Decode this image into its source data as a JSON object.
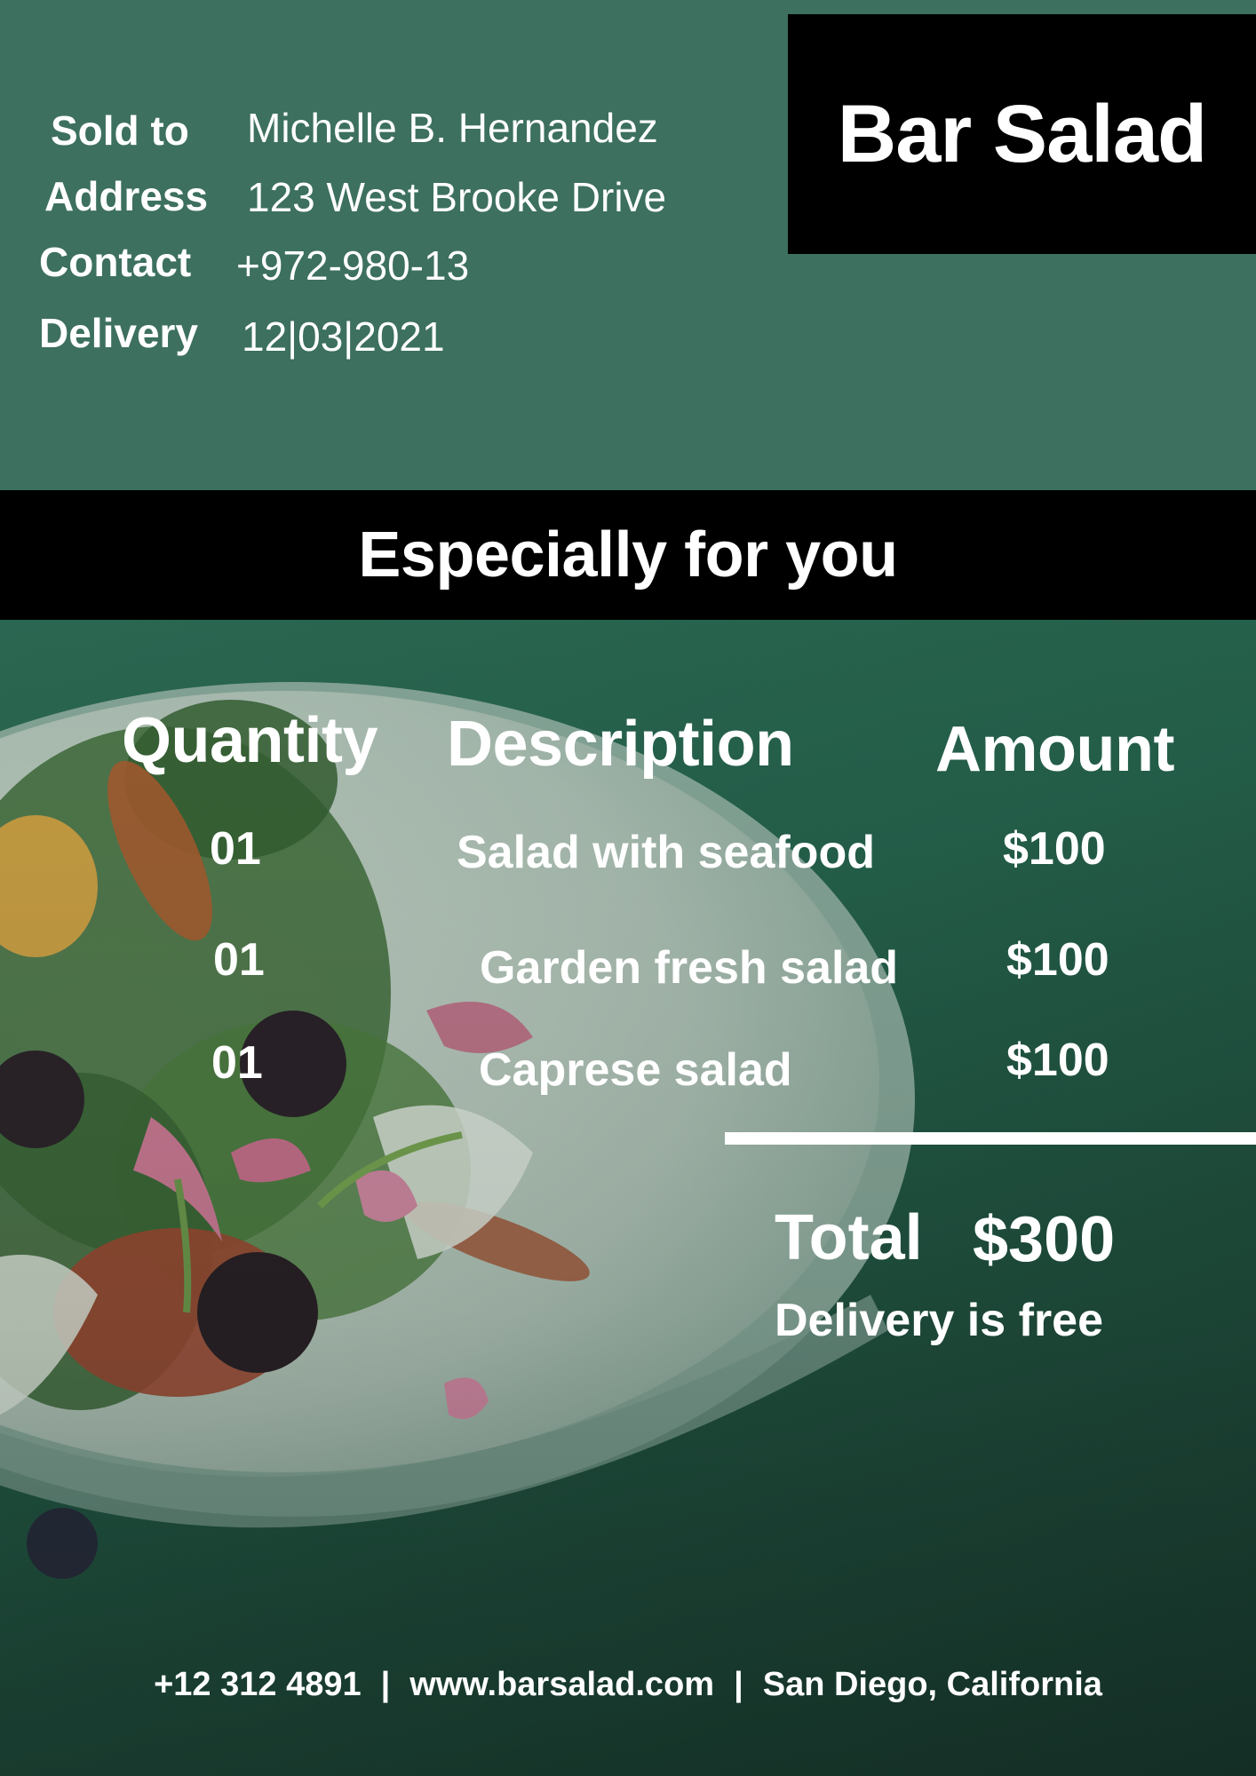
{
  "brand": {
    "name": "Bar Salad"
  },
  "customer": {
    "sold_to_label": "Sold to",
    "sold_to_value": "Michelle B. Hernandez",
    "address_label": "Address",
    "address_value": "123 West Brooke Drive",
    "contact_label": "Contact",
    "contact_value": "+972-980-13",
    "delivery_label": "Delivery",
    "delivery_value": "12|03|2021"
  },
  "banner": {
    "text": "Especially for you"
  },
  "table": {
    "headers": {
      "quantity": "Quantity",
      "description": "Description",
      "amount": "Amount"
    },
    "rows": [
      {
        "quantity": "01",
        "description": "Salad with seafood",
        "amount": "$100"
      },
      {
        "quantity": "01",
        "description": "Garden fresh salad",
        "amount": "$100"
      },
      {
        "quantity": "01",
        "description": "Caprese salad",
        "amount": "$100"
      }
    ]
  },
  "summary": {
    "total_label": "Total",
    "total_value": "$300",
    "delivery_note": "Delivery is free"
  },
  "footer": {
    "phone": "+12 312 4891",
    "separator": "|",
    "website": "www.barsalad.com",
    "location": "San Diego, California"
  },
  "colors": {
    "header_green": "#3d705e",
    "black_bars": "#000000",
    "text": "#ffffff"
  }
}
